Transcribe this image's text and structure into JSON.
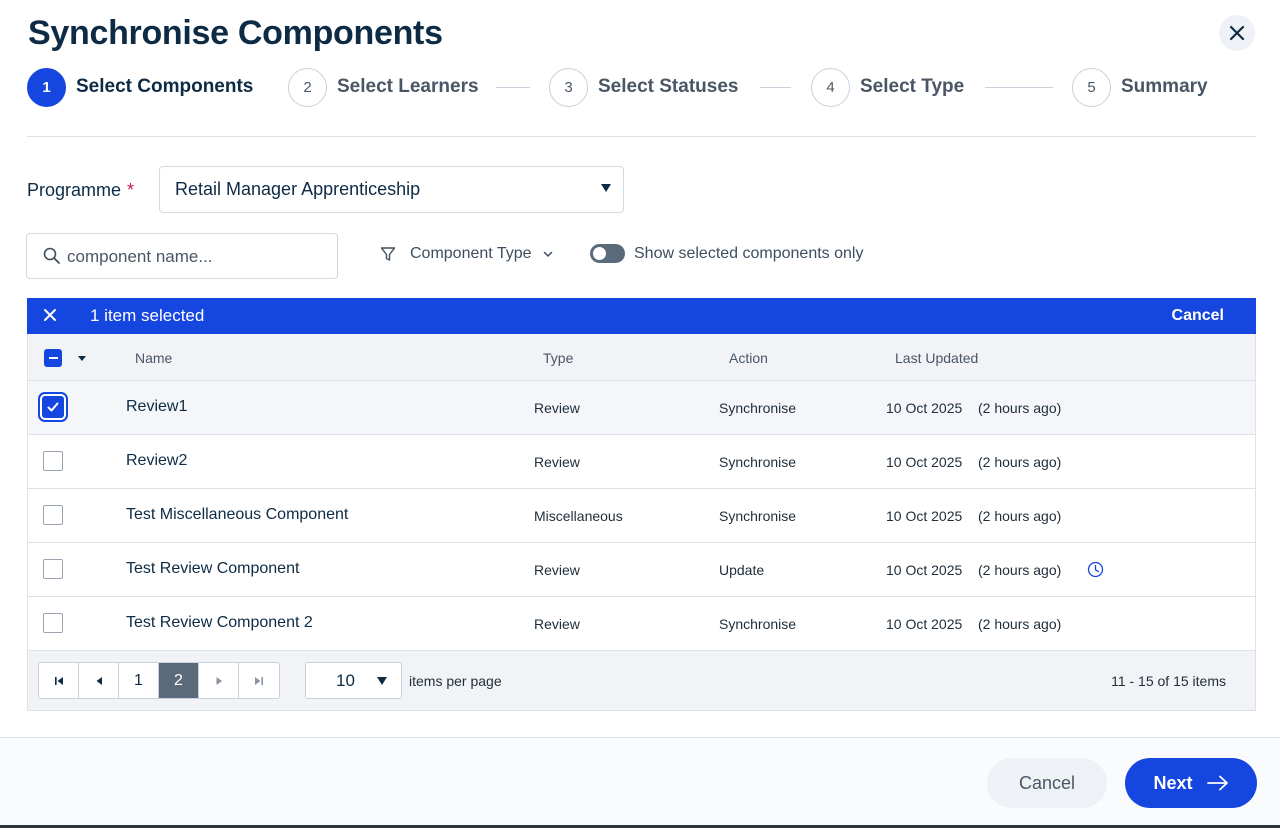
{
  "dialog": {
    "title": "Synchronise Components"
  },
  "stepper": [
    {
      "num": "1",
      "label": "Select Components"
    },
    {
      "num": "2",
      "label": "Select Learners"
    },
    {
      "num": "3",
      "label": "Select Statuses"
    },
    {
      "num": "4",
      "label": "Select Type"
    },
    {
      "num": "5",
      "label": "Summary"
    }
  ],
  "programme": {
    "label": "Programme",
    "required_mark": "*",
    "value": "Retail Manager Apprenticeship"
  },
  "search": {
    "placeholder": "component name..."
  },
  "filter": {
    "component_type_label": "Component Type"
  },
  "toggle": {
    "label": "Show selected components only",
    "on": false
  },
  "selection_bar": {
    "text": "1 item selected",
    "cancel_label": "Cancel"
  },
  "grid": {
    "columns": [
      "Name",
      "Type",
      "Action",
      "Last Updated"
    ],
    "rows": [
      {
        "name": "Review1",
        "type": "Review",
        "action": "Synchronise",
        "date": "10 Oct 2025",
        "ago": "(2 hours ago)",
        "checked": true,
        "clock": false
      },
      {
        "name": "Review2",
        "type": "Review",
        "action": "Synchronise",
        "date": "10 Oct 2025",
        "ago": "(2 hours ago)",
        "checked": false,
        "clock": false
      },
      {
        "name": "Test Miscellaneous Component",
        "type": "Miscellaneous",
        "action": "Synchronise",
        "date": "10 Oct 2025",
        "ago": "(2 hours ago)",
        "checked": false,
        "clock": false
      },
      {
        "name": "Test Review Component",
        "type": "Review",
        "action": "Update",
        "date": "10 Oct 2025",
        "ago": "(2 hours ago)",
        "checked": false,
        "clock": true
      },
      {
        "name": "Test Review Component 2",
        "type": "Review",
        "action": "Synchronise",
        "date": "10 Oct 2025",
        "ago": "(2 hours ago)",
        "checked": false,
        "clock": false
      }
    ]
  },
  "pager": {
    "pages": [
      "1",
      "2"
    ],
    "current_page": "2",
    "page_size": "10",
    "per_page_label": "items per page",
    "info": "11 - 15 of 15 items"
  },
  "footer": {
    "cancel_label": "Cancel",
    "next_label": "Next"
  },
  "colors": {
    "primary": "#1646e0",
    "title": "#0d2b45",
    "required": "#d0164a"
  }
}
